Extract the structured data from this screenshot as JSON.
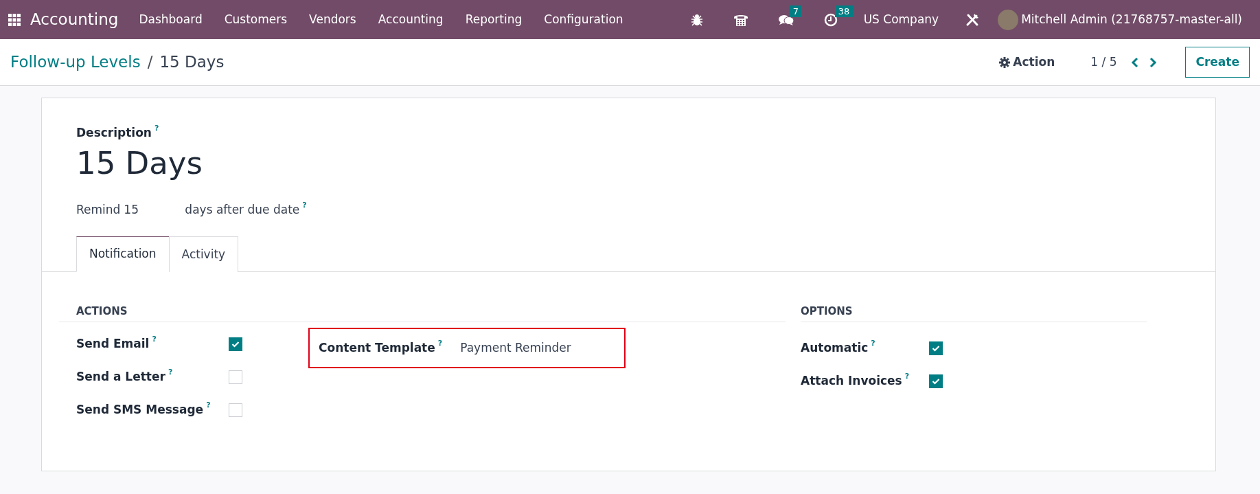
{
  "navbar": {
    "app_title": "Accounting",
    "menu": [
      "Dashboard",
      "Customers",
      "Vendors",
      "Accounting",
      "Reporting",
      "Configuration"
    ],
    "messages_count": "7",
    "activities_count": "38",
    "company": "US Company",
    "user": "Mitchell Admin (21768757-master-all)"
  },
  "control_panel": {
    "breadcrumb_parent": "Follow-up Levels",
    "breadcrumb_separator": "/",
    "breadcrumb_current": "15 Days",
    "action": "Action",
    "pager": "1 / 5",
    "create": "Create"
  },
  "form": {
    "description_label": "Description",
    "description_help": "?",
    "description": "15 Days",
    "remind": {
      "label": "Remind",
      "value": "15",
      "suffix": "days after due date",
      "help": "?"
    },
    "tabs": [
      {
        "label": "Notification",
        "selected": true
      },
      {
        "label": "Activity",
        "selected": false
      }
    ],
    "actions": {
      "title": "ACTIONS",
      "items": [
        {
          "label": "Send Email",
          "help": "?",
          "checked": true
        },
        {
          "label": "Send a Letter",
          "help": "?",
          "checked": false
        },
        {
          "label": "Send SMS Message",
          "help": "?",
          "checked": false
        }
      ],
      "content_template": {
        "label": "Content Template",
        "help": "?",
        "value": "Payment Reminder"
      }
    },
    "options": {
      "title": "OPTIONS",
      "items": [
        {
          "label": "Automatic",
          "help": "?",
          "checked": true
        },
        {
          "label": "Attach Invoices",
          "help": "?",
          "checked": true
        }
      ]
    }
  }
}
